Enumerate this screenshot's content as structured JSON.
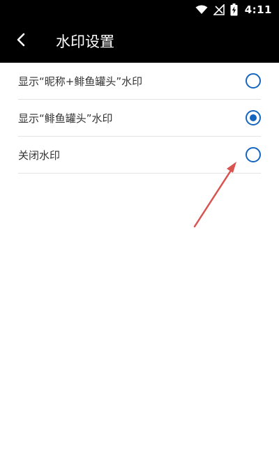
{
  "status_bar": {
    "time": "4:11",
    "icons": [
      "wifi-icon",
      "signal-icon",
      "battery-charging-icon"
    ]
  },
  "header": {
    "title": "水印设置",
    "back_icon": "chevron-left-icon"
  },
  "watermark_options": [
    {
      "label": "显示“昵称+鲱鱼罐头”水印",
      "selected": false
    },
    {
      "label": "显示“鲱鱼罐头”水印",
      "selected": true
    },
    {
      "label": "关闭水印",
      "selected": false
    }
  ],
  "colors": {
    "bar_background": "#000000",
    "accent": "#1565c0",
    "annotation": "#d9534f",
    "divider": "#e3e3e3"
  }
}
